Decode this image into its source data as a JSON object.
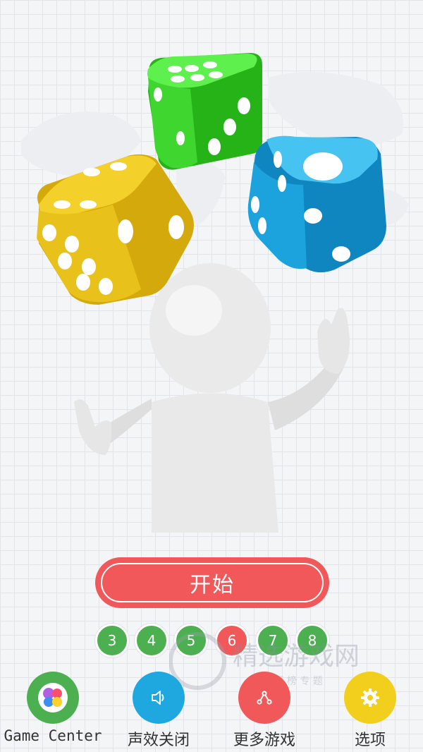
{
  "start": {
    "label": "开始"
  },
  "counts": [
    {
      "label": "3",
      "active": false
    },
    {
      "label": "4",
      "active": false
    },
    {
      "label": "5",
      "active": false
    },
    {
      "label": "6",
      "active": true
    },
    {
      "label": "7",
      "active": false
    },
    {
      "label": "8",
      "active": false
    }
  ],
  "bottom_bar": {
    "game_center": {
      "label": "Game Center",
      "icon": "game-center-icon",
      "color": "#4caf50"
    },
    "sound": {
      "label": "声效关闭",
      "icon": "speaker-icon",
      "color": "#1fa8e0"
    },
    "more_games": {
      "label": "更多游戏",
      "icon": "share-icon",
      "color": "#f0585a"
    },
    "options": {
      "label": "选项",
      "icon": "gear-icon",
      "color": "#f2cf1d"
    }
  },
  "watermark": {
    "title": "精选游戏网",
    "subtitle": "排 行 榜 专 题"
  },
  "colors": {
    "dice_green": "#3dd62e",
    "dice_yellow": "#e8c21a",
    "dice_blue": "#1ca3dd",
    "active_count": "#f0585a",
    "inactive_count": "#4caf50"
  }
}
